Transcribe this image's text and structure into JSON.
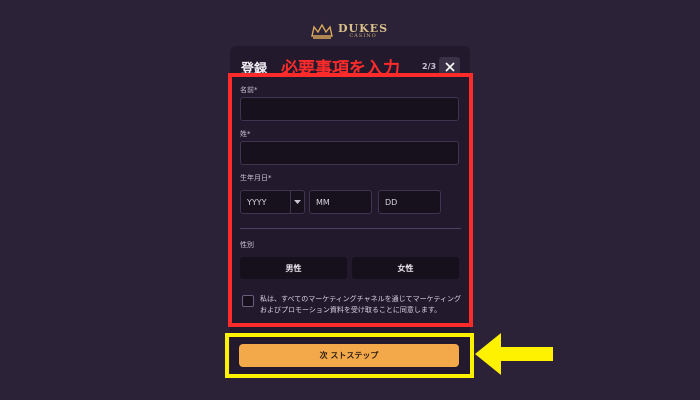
{
  "brand": {
    "name": "DUKES",
    "tagline": "CASINO"
  },
  "modal": {
    "title": "登録",
    "annotation": "必要事項を入力",
    "step": "2/3"
  },
  "form": {
    "first_name_label": "名前*",
    "first_name_value": "",
    "last_name_label": "姓*",
    "last_name_value": "",
    "dob_label": "生年月日*",
    "dob_year_placeholder": "YYYY",
    "dob_month_placeholder": "MM",
    "dob_day_placeholder": "DD",
    "gender_label": "性別",
    "gender_options": [
      "男性",
      "女性"
    ],
    "consent_text": "私は、すべてのマーケティングチャネルを通じてマーケティングおよびプロモーション資料を受け取ることに同意します。",
    "next_label": "次 ストステップ"
  },
  "colors": {
    "background": "#2c2238",
    "modal": "#221a2c",
    "annotation_red": "#ff2b2b",
    "highlight_yellow": "#fff200",
    "button_orange": "#f3a84a"
  }
}
